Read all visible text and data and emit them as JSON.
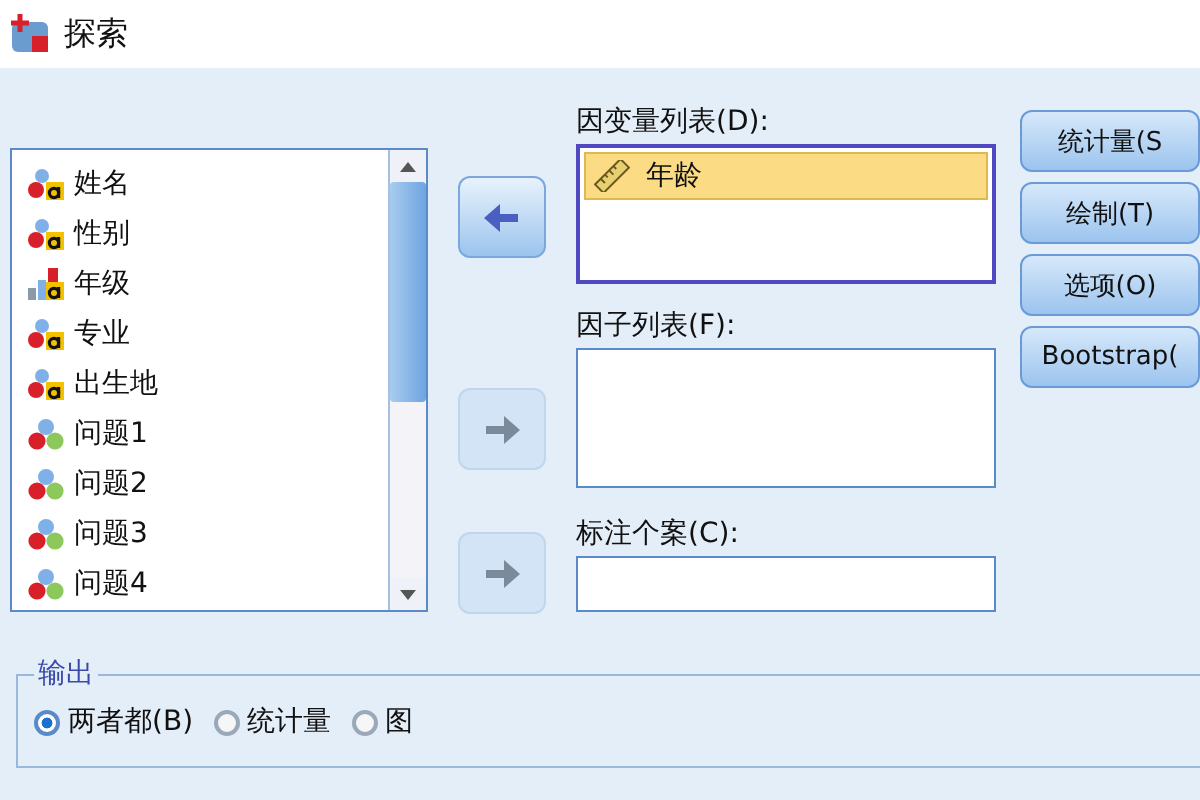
{
  "window": {
    "title": "探索"
  },
  "variables": [
    {
      "name": "姓名",
      "kind": "string"
    },
    {
      "name": "性别",
      "kind": "string"
    },
    {
      "name": "年级",
      "kind": "ordinal"
    },
    {
      "name": "专业",
      "kind": "string"
    },
    {
      "name": "出生地",
      "kind": "string"
    },
    {
      "name": "问题1",
      "kind": "nominal"
    },
    {
      "name": "问题2",
      "kind": "nominal"
    },
    {
      "name": "问题3",
      "kind": "nominal"
    },
    {
      "name": "问题4",
      "kind": "nominal"
    }
  ],
  "dependent_list": {
    "label": "因变量列表(D):",
    "items": [
      {
        "name": "年龄",
        "kind": "scale",
        "selected": true
      }
    ]
  },
  "factor_list": {
    "label": "因子列表(F):"
  },
  "label_cases": {
    "label": "标注个案(C):"
  },
  "arrow_buttons": [
    {
      "kind": "left",
      "disabled": false
    },
    {
      "kind": "right",
      "disabled": true
    },
    {
      "kind": "right",
      "disabled": true
    }
  ],
  "buttons": [
    "统计量(S",
    "绘制(T)",
    "选项(O)",
    "Bootstrap("
  ],
  "output": {
    "title": "输出",
    "options": [
      {
        "label": "两者都(B)",
        "selected": true
      },
      {
        "label": "统计量",
        "selected": false
      },
      {
        "label": "图",
        "selected": false
      }
    ]
  }
}
